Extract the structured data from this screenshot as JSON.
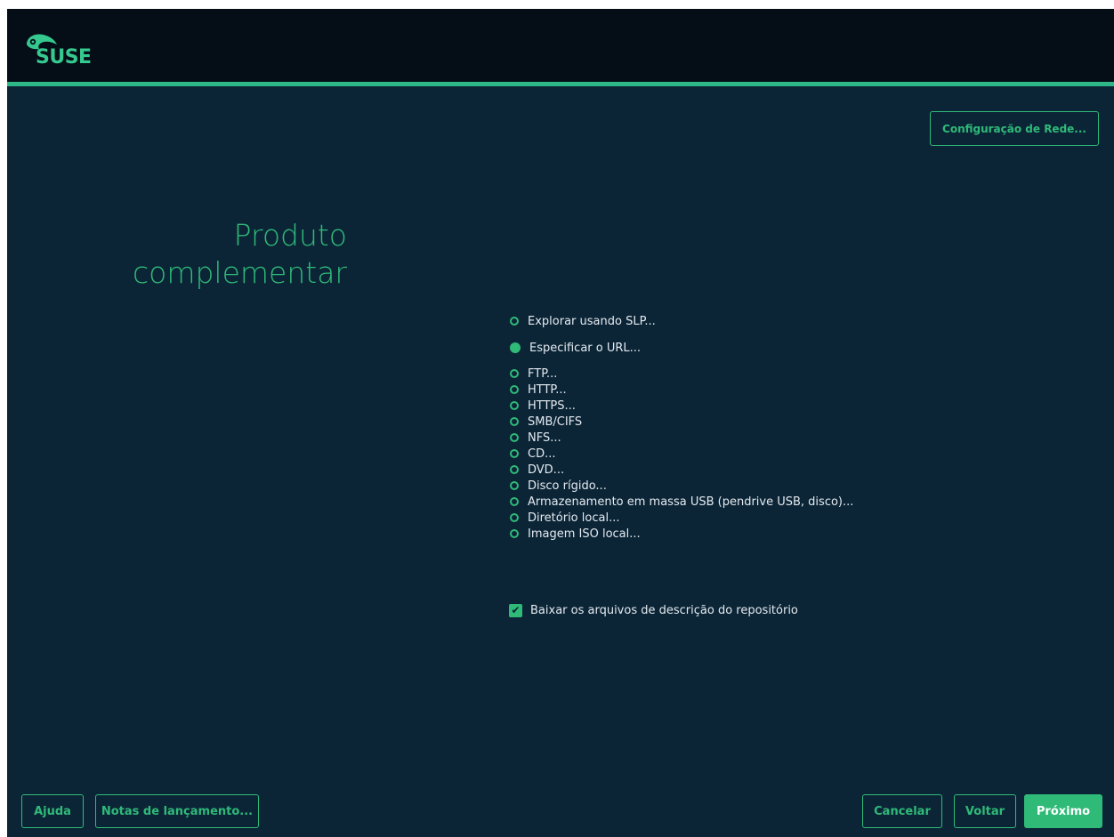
{
  "header": {
    "logo_text": "SUSE",
    "network_button": "Configuração de Rede..."
  },
  "title": {
    "line1": "Produto",
    "line2": "complementar"
  },
  "source_options": [
    {
      "label": "Explorar usando SLP...",
      "selected": false
    },
    {
      "label": "Especificar o URL...",
      "selected": true
    },
    {
      "label": "FTP...",
      "selected": false
    },
    {
      "label": "HTTP...",
      "selected": false
    },
    {
      "label": "HTTPS...",
      "selected": false
    },
    {
      "label": "SMB/CIFS",
      "selected": false
    },
    {
      "label": "NFS...",
      "selected": false
    },
    {
      "label": "CD...",
      "selected": false
    },
    {
      "label": "DVD...",
      "selected": false
    },
    {
      "label": "Disco rígido...",
      "selected": false
    },
    {
      "label": "Armazenamento em massa USB (pendrive USB, disco)...",
      "selected": false
    },
    {
      "label": "Diretório local...",
      "selected": false
    },
    {
      "label": "Imagem ISO local...",
      "selected": false
    }
  ],
  "download_checkbox": {
    "label": "Baixar os arquivos de descrição do repositório",
    "checked": true
  },
  "footer": {
    "help": "Ajuda",
    "release_notes": "Notas de lançamento...",
    "cancel": "Cancelar",
    "back": "Voltar",
    "next": "Próximo"
  },
  "colors": {
    "accent": "#30ba78",
    "background": "#0b2537",
    "header": "#050e16"
  }
}
